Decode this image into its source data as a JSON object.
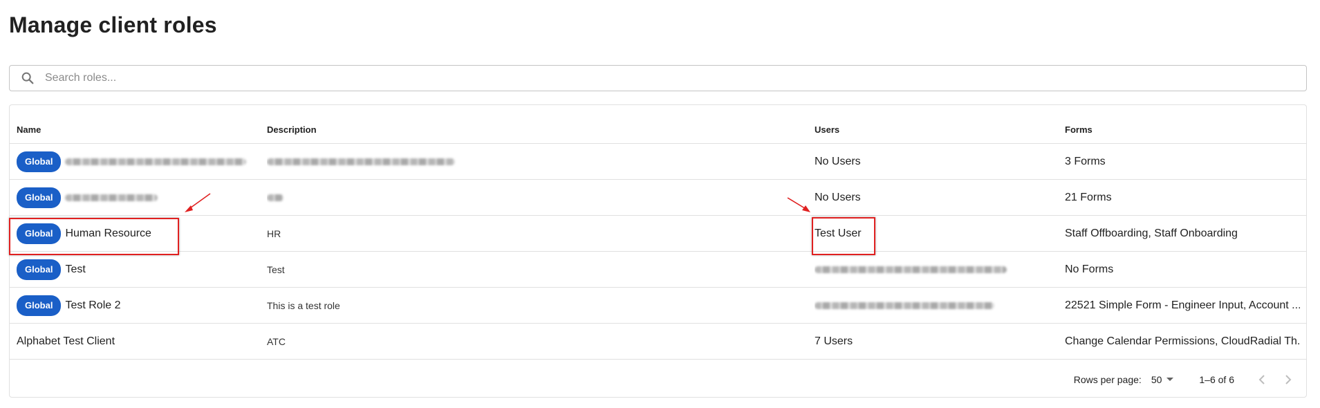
{
  "page": {
    "title": "Manage client roles"
  },
  "search": {
    "placeholder": "Search roles..."
  },
  "table": {
    "columns": {
      "name": "Name",
      "description": "Description",
      "users": "Users",
      "forms": "Forms"
    },
    "rows": [
      {
        "badge": "Global",
        "name": "",
        "name_blurred": true,
        "description": "",
        "description_blurred": true,
        "users": "No Users",
        "forms": "3 Forms"
      },
      {
        "badge": "Global",
        "name": "",
        "name_blurred": true,
        "description": "",
        "description_blurred": true,
        "users": "No Users",
        "forms": "21 Forms"
      },
      {
        "badge": "Global",
        "name": "Human Resource",
        "description": "HR",
        "users": "Test User",
        "forms": "Staff Offboarding, Staff Onboarding"
      },
      {
        "badge": "Global",
        "name": "Test",
        "description": "Test",
        "users": "",
        "users_blurred": true,
        "forms": "No Forms"
      },
      {
        "badge": "Global",
        "name": "Test Role 2",
        "description": "This is a test role",
        "users": "",
        "users_blurred": true,
        "forms": "22521 Simple Form - Engineer Input, Account ..."
      },
      {
        "badge": "",
        "name": "Alphabet Test Client",
        "description": "ATC",
        "users": "7 Users",
        "forms": "Change Calendar Permissions, CloudRadial Th..."
      }
    ]
  },
  "pagination": {
    "rows_per_page_label": "Rows per page:",
    "rows_per_page": "50",
    "range": "1–6 of 6"
  },
  "icons": {
    "search": "search-icon",
    "dropdown": "caret-down-icon",
    "prev": "chevron-left-icon",
    "next": "chevron-right-icon"
  },
  "colors": {
    "badge": "#1a5fc7",
    "annotation": "#e02020",
    "border": "#e0e0e0"
  }
}
